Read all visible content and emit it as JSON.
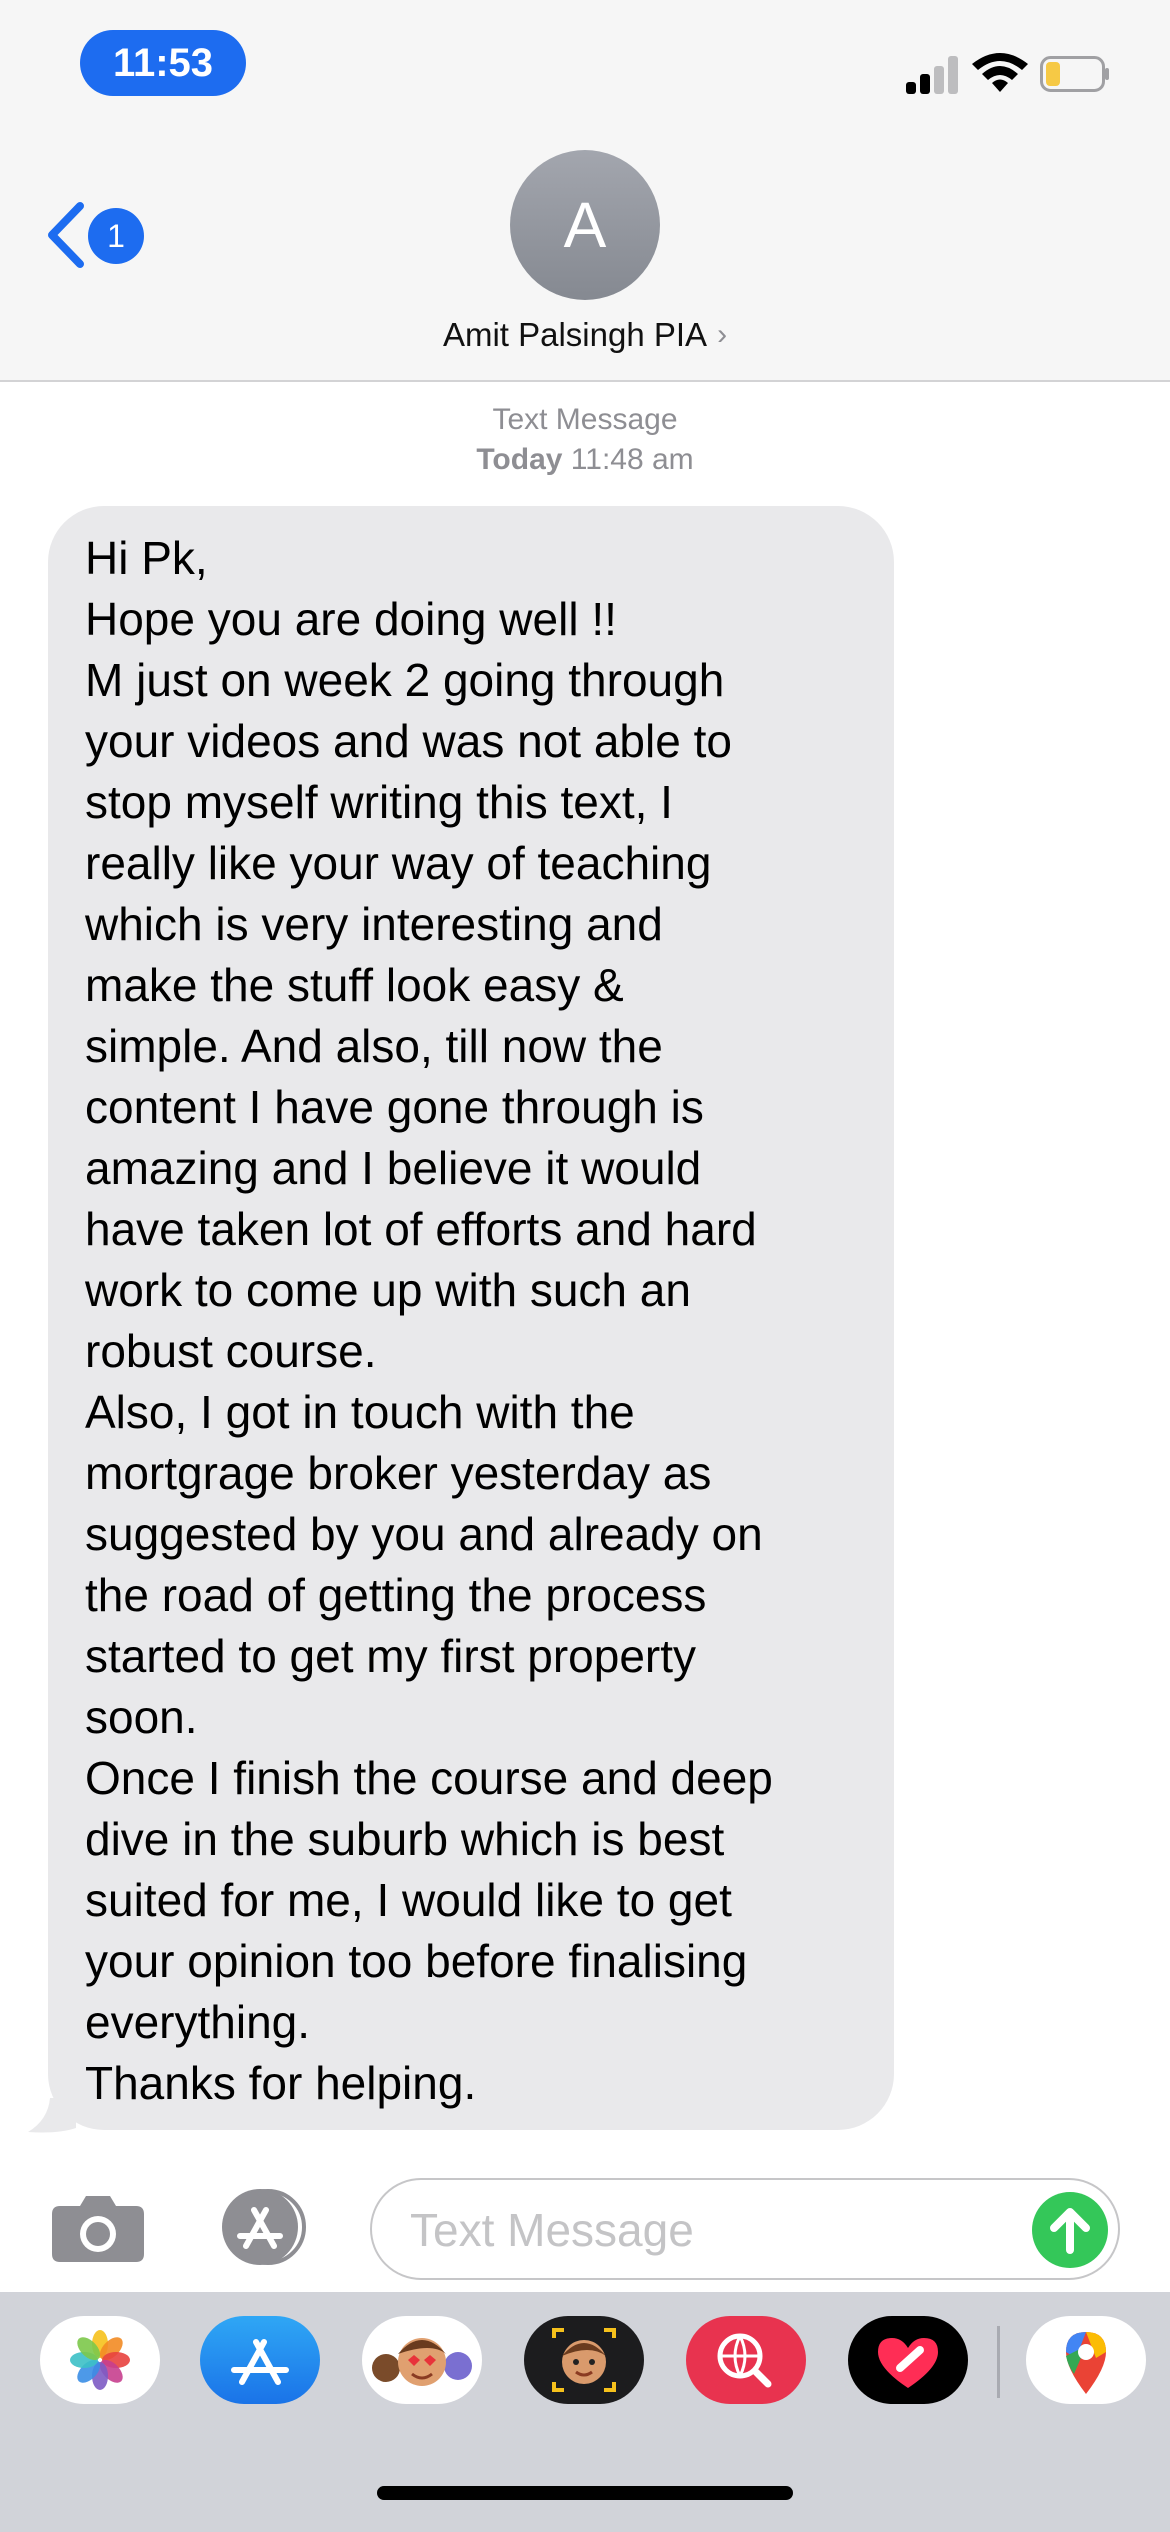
{
  "status_bar": {
    "time": "11:53",
    "icons": [
      "cellular-signal-icon",
      "wifi-icon",
      "low-battery-icon"
    ],
    "accent_color": "#1d6cf0",
    "battery_color": "#f6c945"
  },
  "header": {
    "back_icon": "chevron-left-icon",
    "unread_count": "1",
    "avatar_initial": "A",
    "contact_name": "Amit Palsingh PIA",
    "contact_chevron": "›"
  },
  "thread": {
    "service_label": "Text Message",
    "timestamp_day": "Today",
    "timestamp_time": "11:48 am",
    "bubble_color": "#e9e9eb",
    "message_lines": [
      "Hi Pk,",
      "Hope you are doing well  !!",
      "M just on week 2 going  through",
      "your videos and was not able to",
      "stop myself writing this text, I",
      "really like your way of teaching",
      "which is very interesting and",
      "make the stuff look easy &",
      "simple. And also, till now the",
      "content I have gone through is",
      "amazing and I believe it would",
      "have taken lot of efforts and hard",
      "work to come up with such an",
      "robust course.",
      "Also, I got in touch with the",
      "mortgrage broker yesterday as",
      "suggested by you and already on",
      "the road of getting the process",
      "started to get my first property",
      "soon.",
      "Once I finish the course and deep",
      "dive in the suburb which is best",
      "suited for me, I would like to get",
      "your opinion too before finalising",
      "everything.",
      "Thanks for helping."
    ]
  },
  "compose": {
    "camera_icon": "camera-icon",
    "apps_icon": "app-store-icon",
    "placeholder": "Text Message",
    "value": "",
    "send_icon": "arrow-up-icon",
    "send_color": "#34c759"
  },
  "app_drawer": {
    "apps": [
      {
        "name": "photos-app-icon"
      },
      {
        "name": "app-store-app-icon"
      },
      {
        "name": "memoji-stickers-app-icon"
      },
      {
        "name": "memoji-camera-app-icon"
      },
      {
        "name": "web-image-search-app-icon"
      },
      {
        "name": "digital-touch-app-icon"
      },
      {
        "name": "google-maps-app-icon"
      }
    ]
  }
}
